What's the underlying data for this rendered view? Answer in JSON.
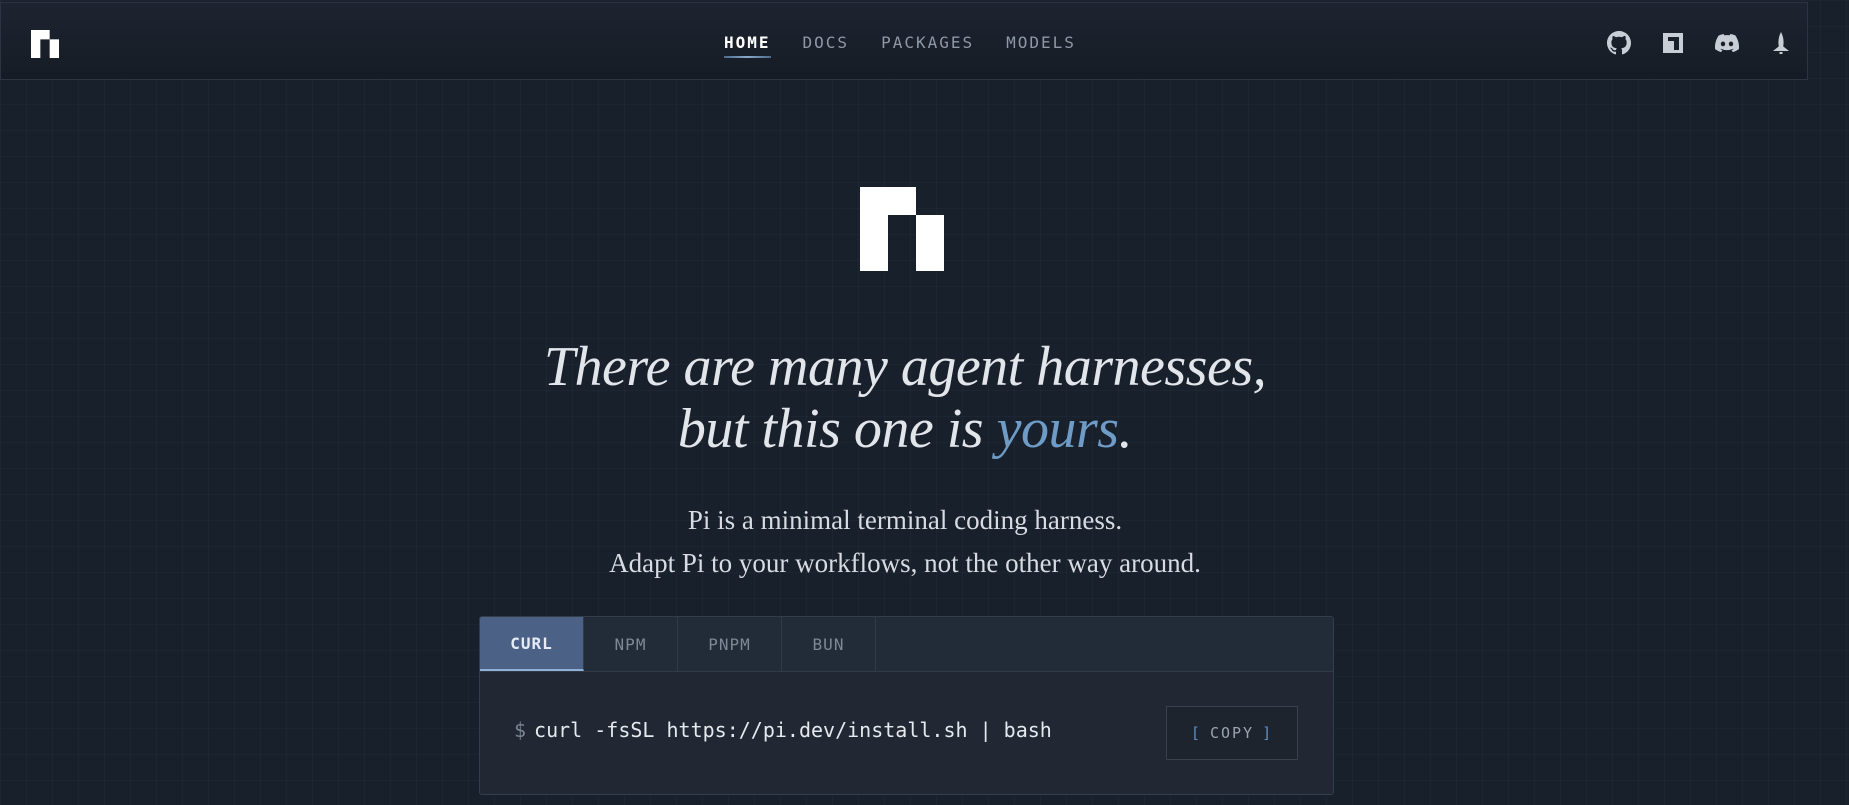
{
  "nav": {
    "items": [
      {
        "label": "HOME",
        "active": true
      },
      {
        "label": "DOCS",
        "active": false
      },
      {
        "label": "PACKAGES",
        "active": false
      },
      {
        "label": "MODELS",
        "active": false
      }
    ],
    "icons": [
      "github-icon",
      "notebook-icon",
      "discord-icon",
      "rocket-icon"
    ]
  },
  "hero": {
    "line1": "There are many agent harnesses,",
    "line2_prefix": "but this one is ",
    "line2_accent": "yours",
    "line2_suffix": ".",
    "subtitle_1": "Pi is a minimal terminal coding harness.",
    "subtitle_2": "Adapt Pi to your workflows, not the other way around."
  },
  "install": {
    "tabs": [
      {
        "label": "CURL",
        "active": true
      },
      {
        "label": "NPM",
        "active": false
      },
      {
        "label": "PNPM",
        "active": false
      },
      {
        "label": "BUN",
        "active": false
      }
    ],
    "prompt": "$",
    "command": "curl -fsSL https://pi.dev/install.sh | bash",
    "copy_label": "COPY",
    "copy_bracket_open": "[",
    "copy_bracket_close": "]"
  },
  "colors": {
    "background": "#18202b",
    "accent": "#6e9cc7",
    "active_tab": "#4b6185"
  }
}
